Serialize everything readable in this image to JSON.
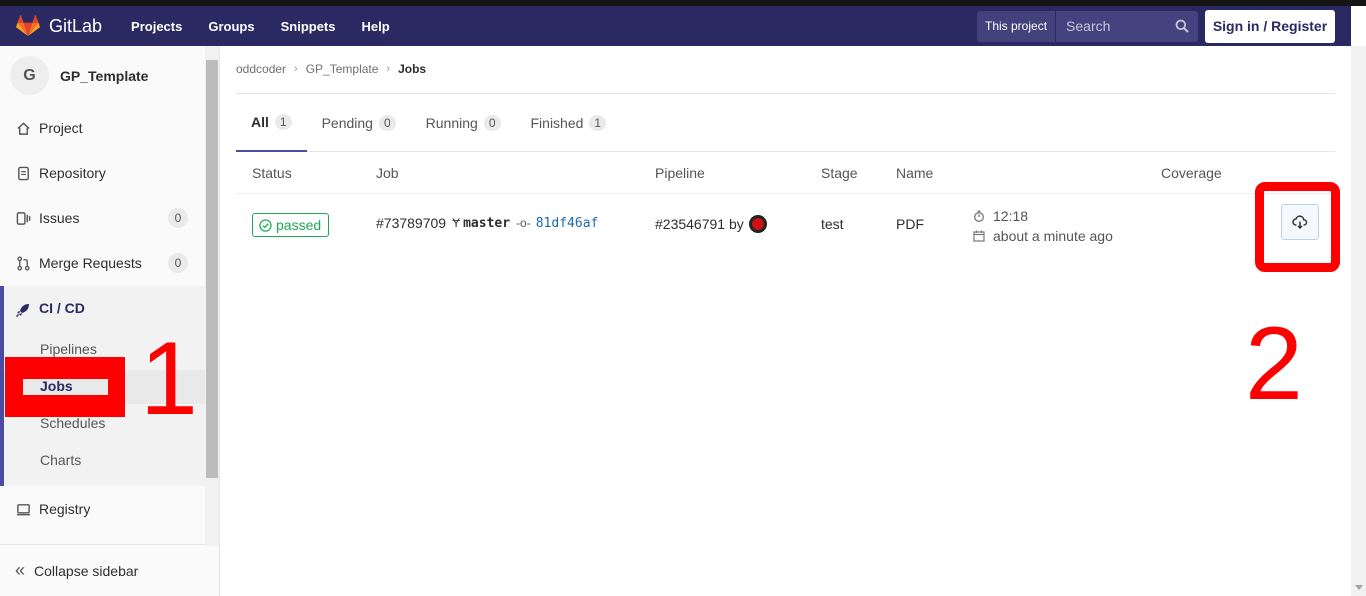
{
  "navbar": {
    "logo_text": "GitLab",
    "links": [
      "Projects",
      "Groups",
      "Snippets",
      "Help"
    ],
    "search_scope": "This project",
    "search_placeholder": "Search",
    "signin_label": "Sign in / Register",
    "bg_color": "#2b2962"
  },
  "sidebar": {
    "project_initial": "G",
    "project_name": "GP_Template",
    "items": [
      {
        "label": "Project",
        "icon": "home-icon"
      },
      {
        "label": "Repository",
        "icon": "doc-icon"
      },
      {
        "label": "Issues",
        "icon": "issues-icon",
        "count": "0"
      },
      {
        "label": "Merge Requests",
        "icon": "merge-request-icon",
        "count": "0"
      }
    ],
    "cicd": {
      "label": "CI / CD",
      "sub": [
        "Pipelines",
        "Jobs",
        "Schedules",
        "Charts"
      ],
      "active": "Jobs"
    },
    "registry": "Registry",
    "collapse": "Collapse sidebar"
  },
  "breadcrumb": [
    "oddcoder",
    "GP_Template",
    "Jobs"
  ],
  "tabs": [
    {
      "label": "All",
      "count": "1",
      "active": true
    },
    {
      "label": "Pending",
      "count": "0"
    },
    {
      "label": "Running",
      "count": "0"
    },
    {
      "label": "Finished",
      "count": "1"
    }
  ],
  "table": {
    "headers": [
      "Status",
      "Job",
      "Pipeline",
      "Stage",
      "Name",
      "Coverage"
    ],
    "row": {
      "status": "passed",
      "job_id": "#73789709",
      "ref": "master",
      "sha": "81df46af",
      "pipeline": "#23546791",
      "by": "by",
      "stage": "test",
      "name": "PDF",
      "duration": "12:18",
      "finished": "about a minute ago"
    }
  },
  "annotations": {
    "one": "1",
    "two": "2"
  },
  "colors": {
    "success": "#1aaa55",
    "accent": "#4b4ba3",
    "annotation": "#ff0000",
    "link": "#1b69b6"
  }
}
